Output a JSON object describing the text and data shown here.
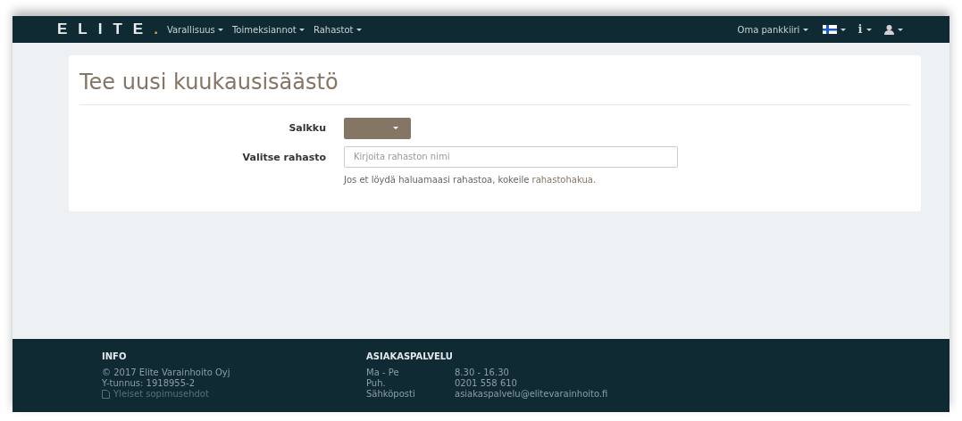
{
  "navbar": {
    "logo": "ELITE",
    "logo_dot": ".",
    "menus": [
      {
        "label": "Varallisuus"
      },
      {
        "label": "Toimeksiannot"
      },
      {
        "label": "Rahastot"
      }
    ],
    "right_menus": [
      {
        "kind": "text",
        "label": "Oma pankkiiri"
      },
      {
        "kind": "flag"
      },
      {
        "kind": "info",
        "label": "i"
      },
      {
        "kind": "user"
      }
    ]
  },
  "page": {
    "title": "Tee uusi kuukausisäästö",
    "form": [
      {
        "kind": "dropdown",
        "label": "Salkku"
      },
      {
        "kind": "input",
        "label": "Valitse rahasto",
        "placeholder": "Kirjoita rahaston nimi",
        "hint": {
          "before": "Jos et löydä haluamaasi rahastoa, kokeile ",
          "link": "rahastohakua",
          "after": "."
        }
      }
    ]
  },
  "footer": {
    "info": {
      "title": "INFO",
      "lines": [
        "© 2017 Elite Varainhoito Oyj",
        "Y-tunnus: 1918955-2"
      ],
      "link": "Yleiset sopimusehdot"
    },
    "service": {
      "title": "ASIAKASPALVELU",
      "rows": [
        {
          "label": "Ma - Pe",
          "value": "8.30 - 16.30"
        },
        {
          "label": "Puh.",
          "value": "0201 558 610"
        },
        {
          "label": "Sähköposti",
          "value": "asiakaspalvelu@elitevarainhoito.fi"
        }
      ]
    }
  }
}
